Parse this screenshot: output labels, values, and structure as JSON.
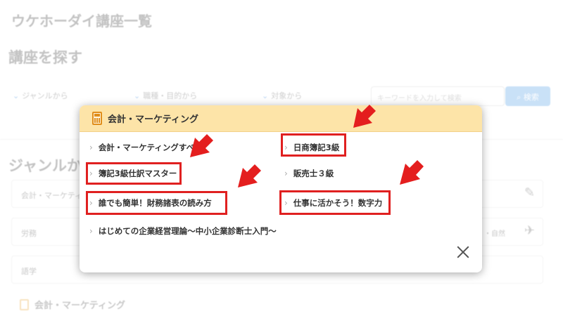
{
  "page": {
    "title": "ウケホーダイ講座一覧",
    "search_heading": "講座を探す",
    "filters": [
      "ジャンルから",
      "職種・目的から",
      "対象から"
    ],
    "search_placeholder": "キーワードを入力して検索",
    "search_button": "検索",
    "genre_heading": "ジャンルか",
    "genre_rows": [
      "会計・マーケティ",
      "労務",
      "語学"
    ],
    "genre_row_right": "・自然",
    "bottom_section_title": "会計・マーケティング"
  },
  "modal": {
    "title": "会計・マーケティング",
    "items": [
      {
        "label": "会計・マーケティングすべ"
      },
      {
        "label": "日商簿記3級"
      },
      {
        "label": "簿記3級仕訳マスター"
      },
      {
        "label": "販売士３級"
      },
      {
        "label": "誰でも簡単！財務諸表の読み方"
      },
      {
        "label": "仕事に活かそう！数字力"
      },
      {
        "label": "はじめての企業経営理論〜中小企業診断士入門〜"
      }
    ]
  },
  "icons": {
    "header_icon": "calculator-icon",
    "item_icon": "chevron-right-icon",
    "close": "close-icon",
    "pen": "pencil-icon",
    "plane": "airplane-icon"
  },
  "colors": {
    "modal_header": "#fde4a8",
    "highlight": "#e02020",
    "accent_blue": "#2b7fd6"
  }
}
